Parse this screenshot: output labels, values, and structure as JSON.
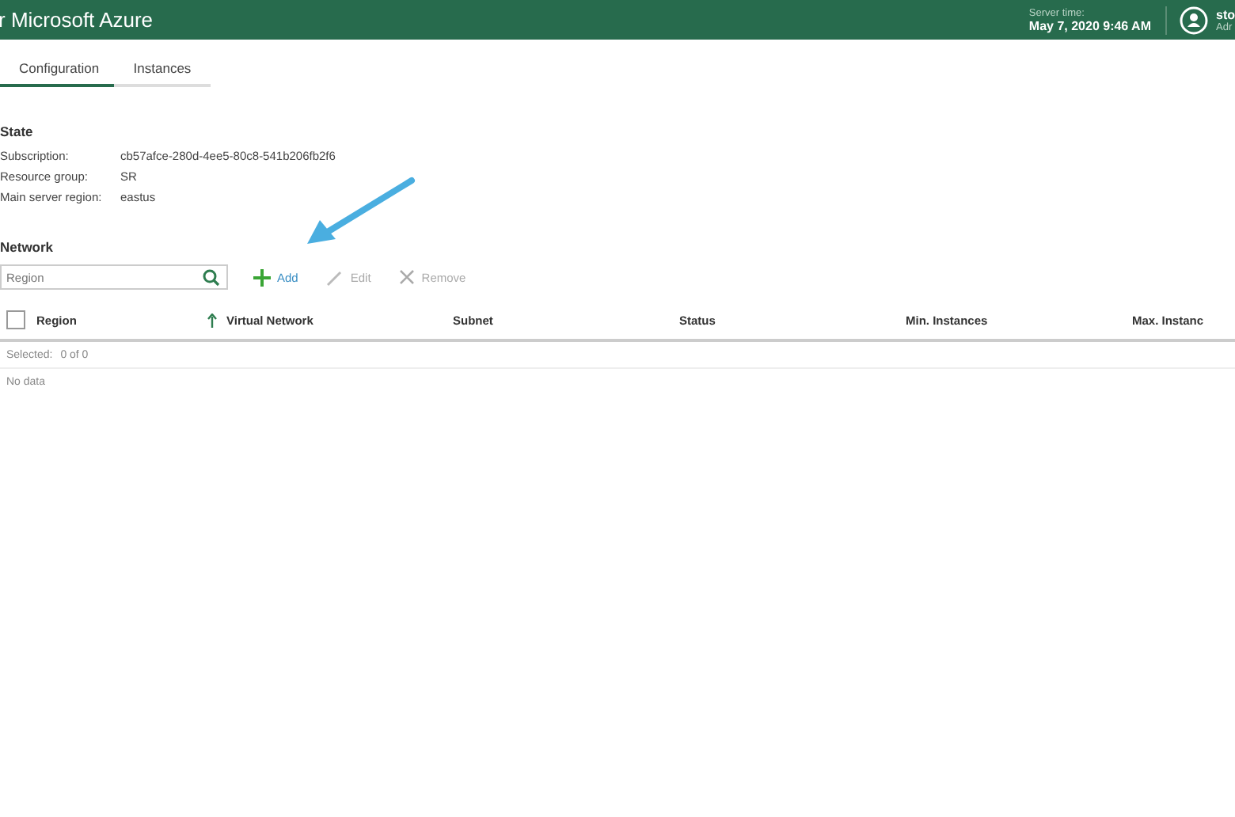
{
  "header": {
    "title": "r Microsoft Azure",
    "server_time_label": "Server time:",
    "server_time": "May 7, 2020 9:46 AM",
    "user_name": "sto",
    "user_role": "Adr"
  },
  "tabs": [
    {
      "label": "Configuration",
      "selected": true
    },
    {
      "label": "Instances",
      "selected": false
    }
  ],
  "state": {
    "heading": "State",
    "fields": [
      {
        "label": "Subscription:",
        "value": "cb57afce-280d-4ee5-80c8-541b206fb2f6"
      },
      {
        "label": "Resource group:",
        "value": "SR"
      },
      {
        "label": "Main server region:",
        "value": "eastus"
      }
    ]
  },
  "network": {
    "heading": "Network",
    "search": {
      "placeholder": "Region"
    },
    "actions": [
      {
        "kind": "add",
        "label": "Add",
        "disabled": false
      },
      {
        "kind": "edit",
        "label": "Edit",
        "disabled": true
      },
      {
        "kind": "remove",
        "label": "Remove",
        "disabled": true
      }
    ],
    "select_all_checked": false,
    "columns": [
      {
        "label": "Region",
        "sorted": true
      },
      {
        "label": "Virtual Network",
        "sorted": false
      },
      {
        "label": "Subnet",
        "sorted": false
      },
      {
        "label": "Status",
        "sorted": false
      },
      {
        "label": "Min. Instances",
        "sorted": false
      },
      {
        "label": "Max. Instanc",
        "sorted": false
      }
    ],
    "selected_label": "Selected:",
    "selected_count": "0 of 0",
    "empty_text": "No data"
  }
}
